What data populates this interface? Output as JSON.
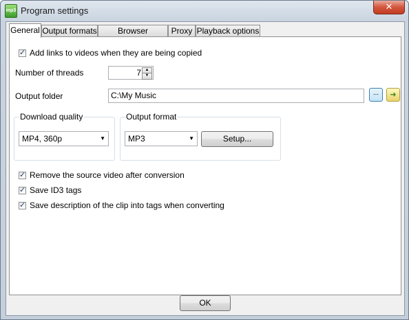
{
  "window": {
    "title": "Program settings",
    "app_icon_text": "mp3",
    "close_glyph": "✕"
  },
  "tabs": [
    {
      "label": "General",
      "active": true
    },
    {
      "label": "Output formats",
      "active": false
    },
    {
      "label": "Browser integration",
      "active": false
    },
    {
      "label": "Proxy",
      "active": false
    },
    {
      "label": "Playback options",
      "active": false
    }
  ],
  "general": {
    "add_links_label": "Add links to videos when they are being copied",
    "add_links_checked": true,
    "threads_label": "Number of threads",
    "threads_value": "7",
    "output_folder_label": "Output folder",
    "output_folder_value": "C:\\My Music",
    "browse_label": "...",
    "download_quality": {
      "label": "Download quality",
      "selected": "MP4, 360p"
    },
    "output_format": {
      "label": "Output format",
      "selected": "MP3",
      "setup_label": "Setup..."
    },
    "remove_source_label": "Remove the source video after conversion",
    "remove_source_checked": true,
    "save_id3_label": "Save ID3 tags",
    "save_id3_checked": true,
    "save_desc_label": "Save description of the clip into tags when converting",
    "save_desc_checked": true
  },
  "footer": {
    "ok_label": "OK"
  },
  "icons": {
    "browse": "ellipsis-icon",
    "open_folder": "open-folder-icon",
    "spin_up": "up-arrow-icon",
    "spin_down": "down-arrow-icon",
    "dropdown": "chevron-down-icon"
  }
}
